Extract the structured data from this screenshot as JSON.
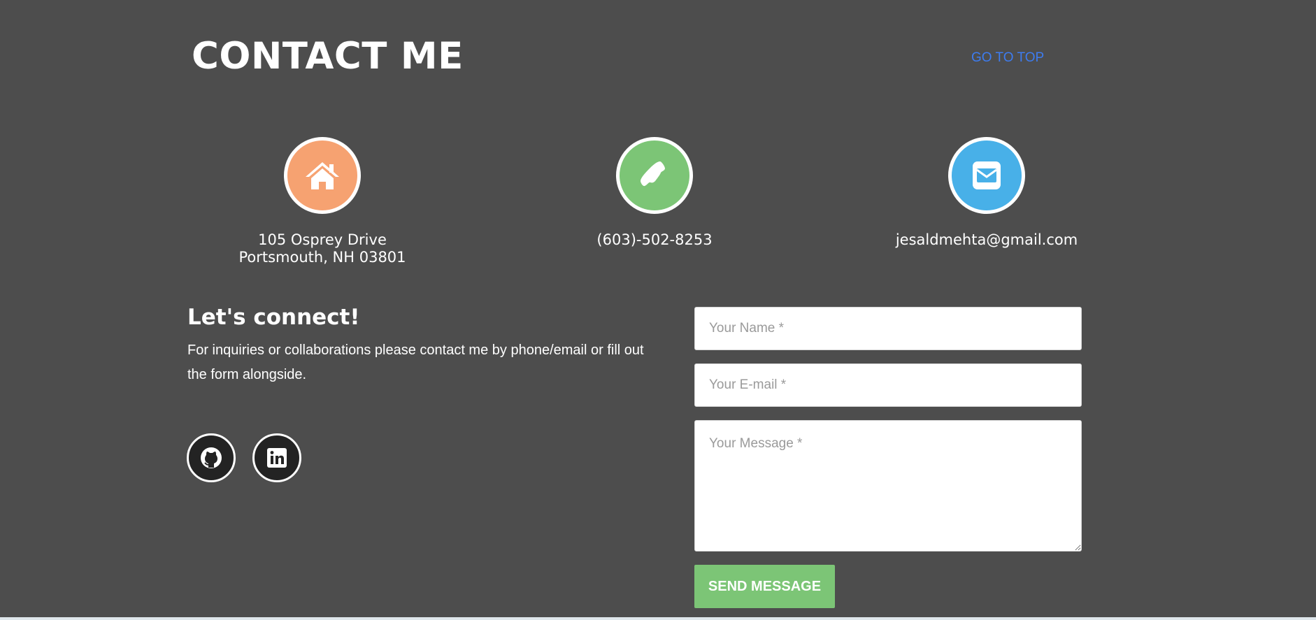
{
  "header": {
    "title": "CONTACT ME",
    "go_top_label": "GO TO TOP"
  },
  "contact_info": {
    "address_line1": "105 Osprey Drive",
    "address_line2": "Portsmouth, NH 03801",
    "phone": "(603)-502-8253",
    "email": "jesaldmehta@gmail.com"
  },
  "icons": {
    "address": "home-icon",
    "phone": "phone-icon",
    "email": "envelope-icon",
    "github": "github-icon",
    "linkedin": "linkedin-icon"
  },
  "connect": {
    "title": "Let's connect!",
    "description": "For inquiries or collaborations please contact me by phone/email or fill out the form alongside."
  },
  "form": {
    "name_placeholder": "Your Name *",
    "email_placeholder": "Your E-mail *",
    "message_placeholder": "Your Message *",
    "name_value": "",
    "email_value": "",
    "message_value": "",
    "submit_label": "SEND MESSAGE"
  },
  "colors": {
    "background": "#4d4d4d",
    "address_circle": "#f6a271",
    "phone_circle": "#7cc576",
    "email_circle": "#48b0e8",
    "link": "#3d7cf0",
    "send_button": "#7cc576",
    "social_circle": "#232323"
  }
}
